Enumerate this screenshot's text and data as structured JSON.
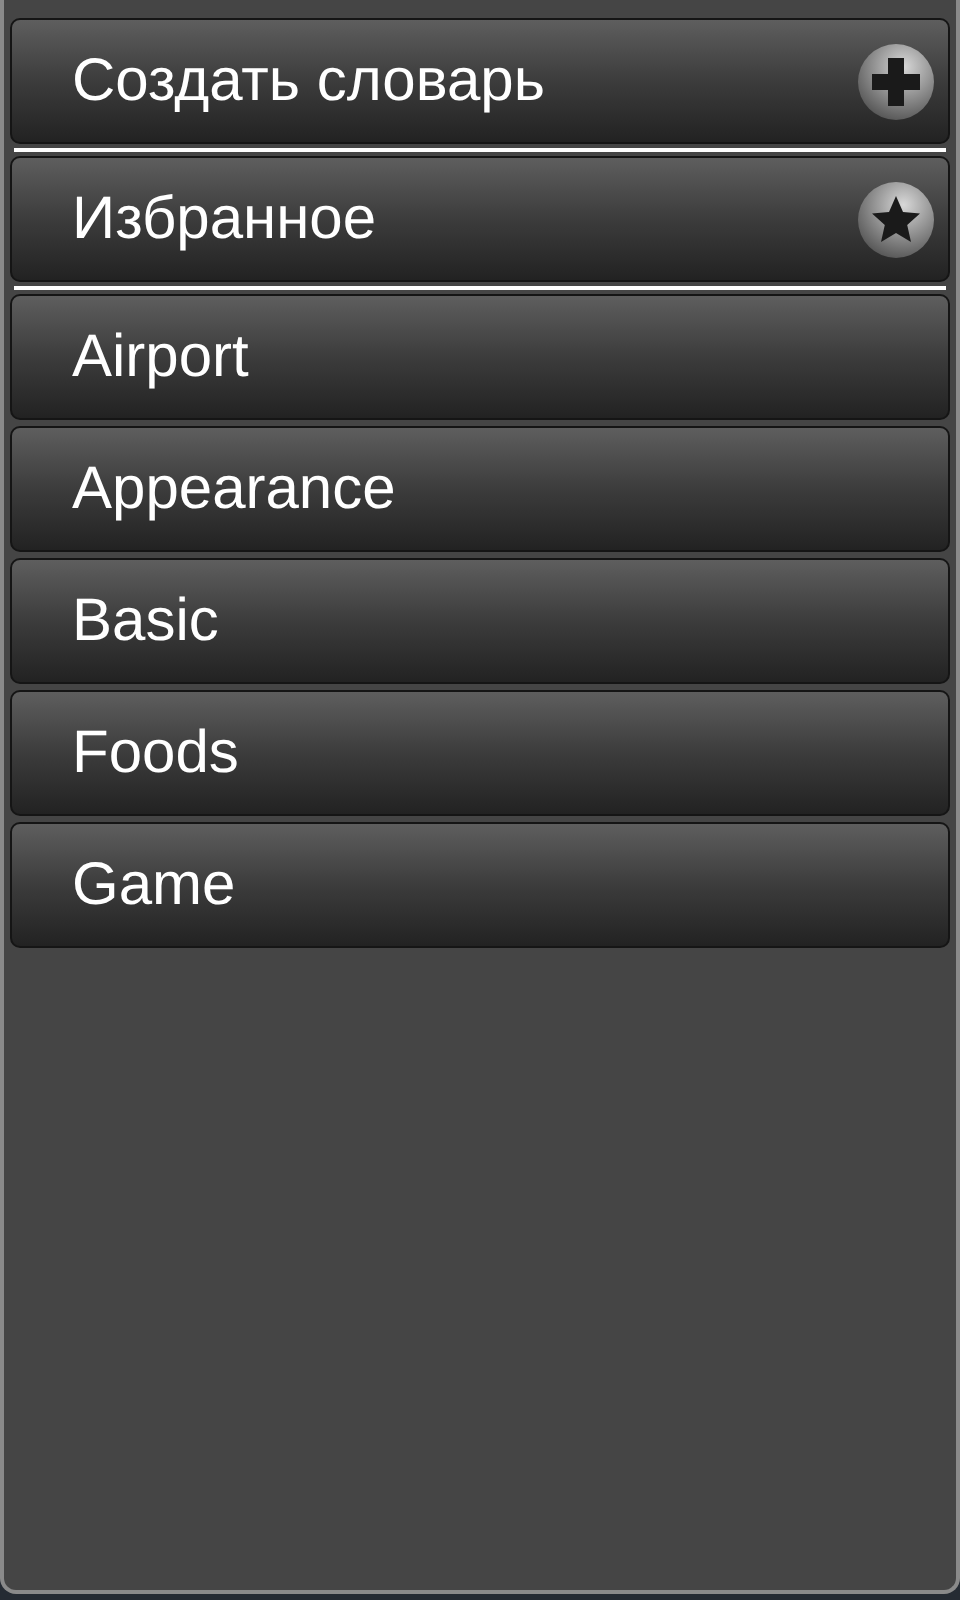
{
  "items": [
    {
      "kind": "add",
      "label": "Создать словарь"
    },
    {
      "kind": "favorites",
      "label": "Избранное"
    },
    {
      "kind": "plain",
      "label": "Airport"
    },
    {
      "kind": "plain",
      "label": "Appearance"
    },
    {
      "kind": "plain",
      "label": "Basic"
    },
    {
      "kind": "plain",
      "label": "Foods"
    },
    {
      "kind": "plain",
      "label": "Game"
    }
  ]
}
